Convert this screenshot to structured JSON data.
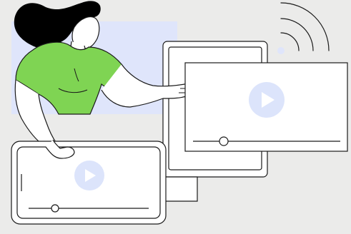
{
  "illustration": {
    "subject": "woman-pointing-at-video-players",
    "icons": [
      "play-icon",
      "play-icon",
      "wifi-signal-icon"
    ],
    "players": [
      {
        "name": "laptop-video-player",
        "progress": 0.17,
        "state": "paused"
      },
      {
        "name": "tablet-video-player",
        "progress": 0.22,
        "state": "paused"
      }
    ]
  },
  "colors": {
    "background": "#ebebea",
    "backdrop_panel": "#dfe5fb",
    "shirt": "#7fd453",
    "play_button": "#dce4fb",
    "play_glyph": "#ffffff",
    "outline": "#1a1a1a",
    "hair": "#000000",
    "surface": "#ffffff"
  }
}
